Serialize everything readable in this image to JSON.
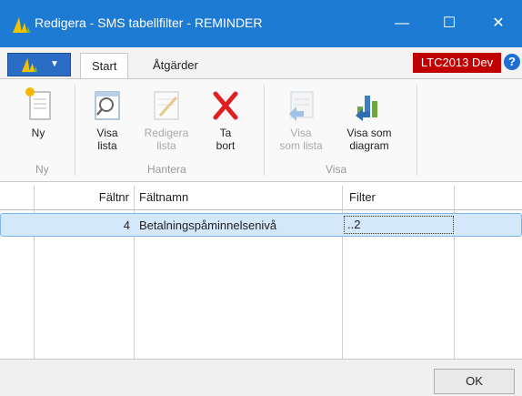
{
  "window": {
    "title": "Redigera - SMS tabellfilter - REMINDER",
    "minimize": "—",
    "maximize": "☐",
    "close": "✕"
  },
  "tabs": [
    {
      "label": "Start"
    },
    {
      "label": "Åtgärder"
    }
  ],
  "badge": {
    "label": "LTC2013 Dev"
  },
  "help": {
    "label": "?"
  },
  "ribbon": {
    "groups": [
      {
        "label": "Ny",
        "buttons": [
          {
            "label": "Ny",
            "icon": "new-document-icon"
          }
        ]
      },
      {
        "label": "Hantera",
        "buttons": [
          {
            "label": "Visa\nlista",
            "icon": "view-list-icon",
            "line1": "Visa",
            "line2": "lista"
          },
          {
            "label": "Redigera lista",
            "icon": "edit-list-icon",
            "line1": "Redigera",
            "line2": "lista",
            "disabled": true
          },
          {
            "label": "Ta bort",
            "icon": "delete-icon",
            "line1": "Ta",
            "line2": "bort"
          }
        ]
      },
      {
        "label": "Visa",
        "buttons": [
          {
            "label": "Visa som lista",
            "icon": "show-as-list-icon",
            "line1": "Visa",
            "line2": "som lista",
            "disabled": true
          },
          {
            "label": "Visa som diagram",
            "icon": "show-as-chart-icon",
            "line1": "Visa som",
            "line2": "diagram"
          }
        ]
      }
    ]
  },
  "grid": {
    "columns": [
      "Fältnr",
      "Fältnamn",
      "Filter"
    ],
    "rows": [
      {
        "faltnr": "4",
        "faltnamn": "Betalningspåminnelsenivå",
        "filter": "..2"
      }
    ]
  },
  "footer": {
    "ok_label": "OK"
  },
  "colors": {
    "titlebar": "#1e7bd3",
    "badge": "#c00000",
    "selected_row": "#d4e8fb"
  }
}
